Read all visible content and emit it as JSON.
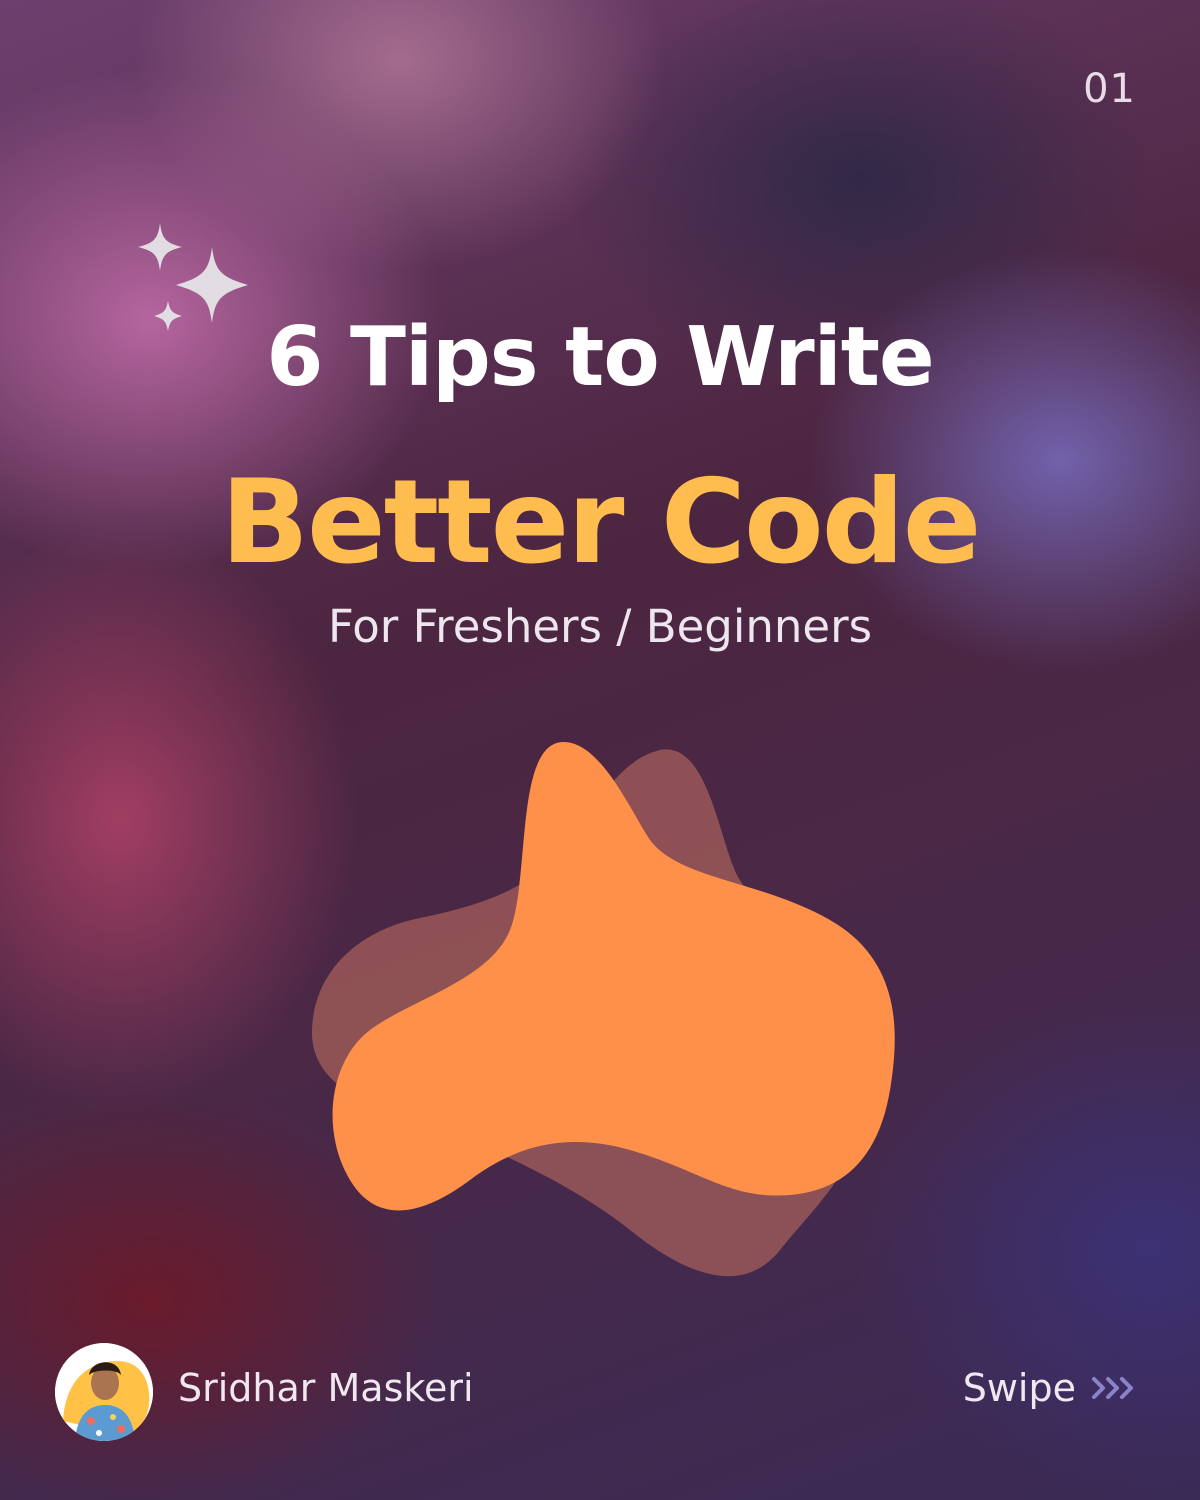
{
  "page_number": "01",
  "title": {
    "line1": "6 Tips to Write",
    "line2": "Better Code",
    "subtitle": "For Freshers / Beginners"
  },
  "footer": {
    "author": "Sridhar Maskeri",
    "swipe_label": "Swipe"
  },
  "icons": {
    "sparkles": "sparkles-icon",
    "swipe_arrows": "triple-chevron-right-icon",
    "avatar": "avatar"
  },
  "colors": {
    "accent_yellow": "#ffbd4f",
    "blob_orange": "#ff9049",
    "blob_shadow": "#b86a5e",
    "text_white": "#ffffff"
  }
}
